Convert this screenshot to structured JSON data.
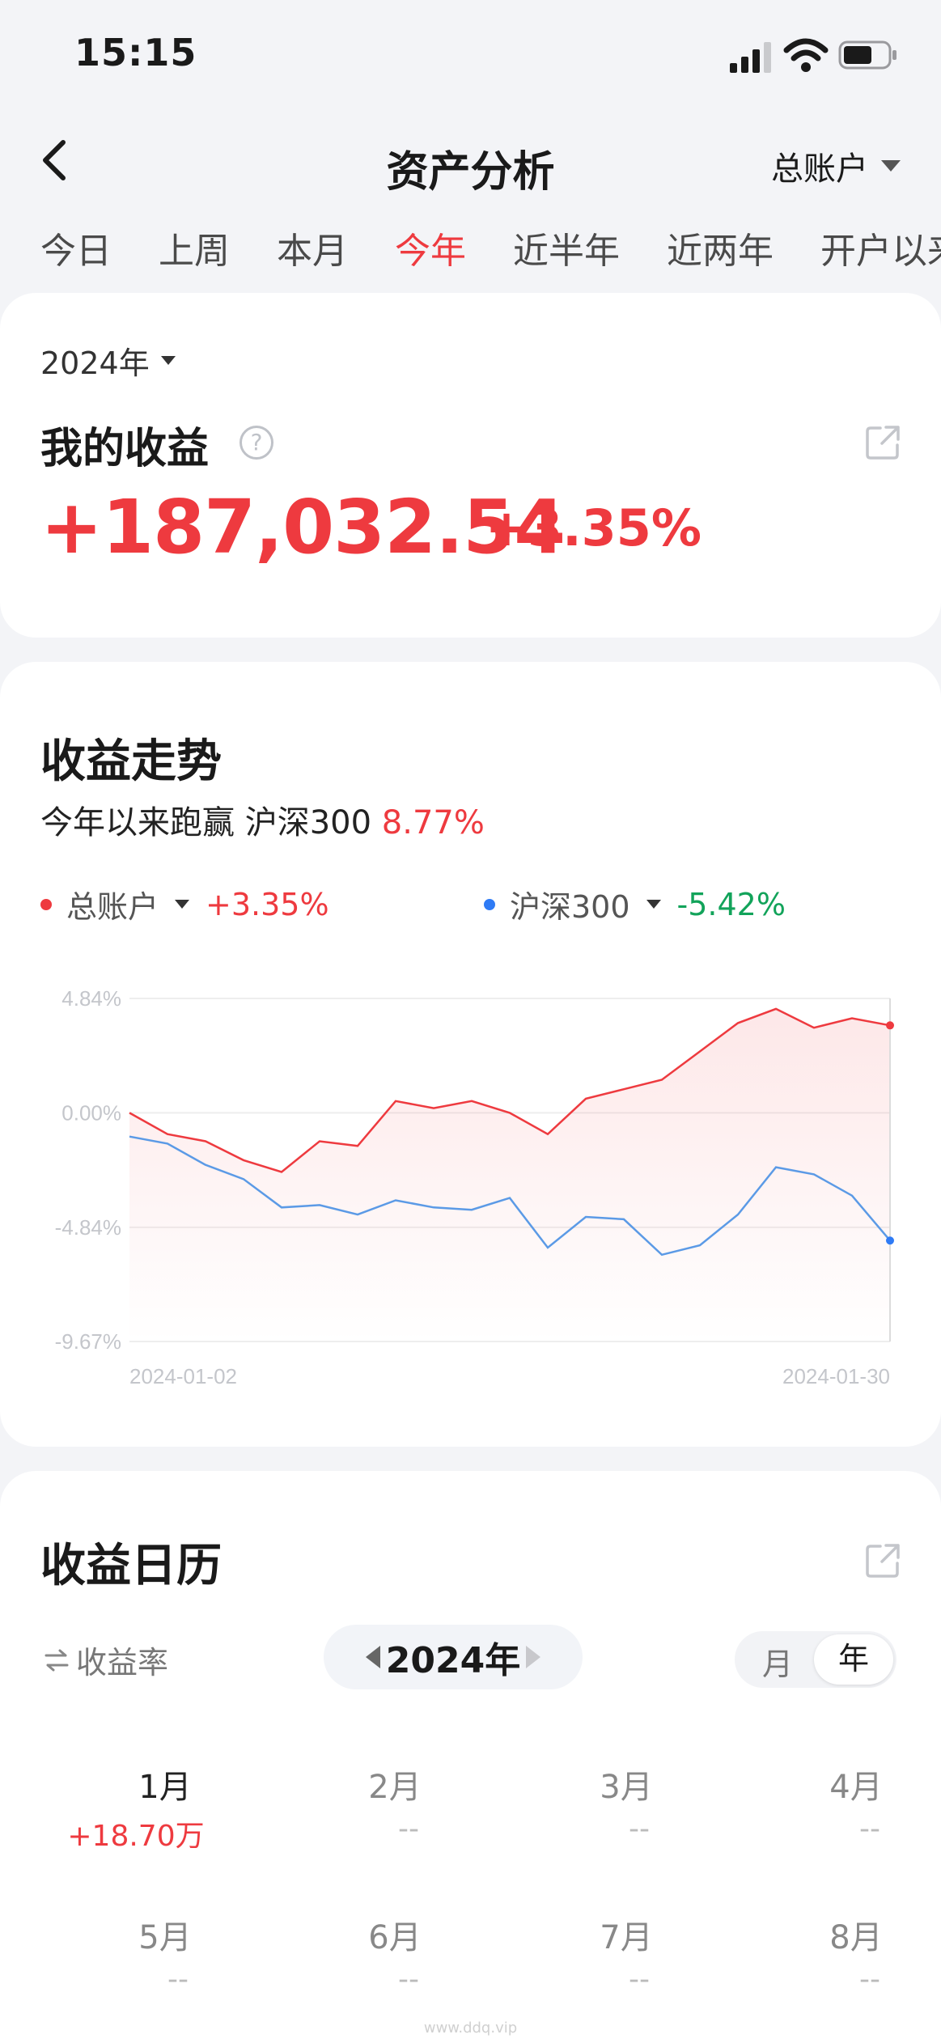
{
  "status": {
    "time": "15:15"
  },
  "nav": {
    "title": "资产分析",
    "account": "总账户"
  },
  "tabs": [
    "今日",
    "上周",
    "本月",
    "今年",
    "近半年",
    "近两年",
    "开户以来"
  ],
  "summary": {
    "year": "2024年",
    "title": "我的收益",
    "help": "?",
    "amount": "+187,032.54",
    "pct": "+3.35%"
  },
  "trend": {
    "title": "收益走势",
    "beat_text": "今年以来跑赢 沪深300",
    "beat_pct": "8.77%",
    "legend": [
      {
        "name": "总账户",
        "value": "+3.35%",
        "color": "#ee3a3f"
      },
      {
        "name": "沪深300",
        "value": "-5.42%",
        "color": "#2f7bf5"
      }
    ]
  },
  "chart_data": {
    "type": "line",
    "y_ticks": [
      "4.84%",
      "0.00%",
      "-4.84%",
      "-9.67%"
    ],
    "ylim": [
      -9.67,
      4.84
    ],
    "x_labels": [
      "2024-01-02",
      "2024-01-30"
    ],
    "series": [
      {
        "name": "总账户",
        "color": "#ee3a3f",
        "values": [
          0.0,
          -0.9,
          -1.2,
          -2.0,
          -2.5,
          -1.2,
          -1.4,
          0.5,
          0.2,
          0.5,
          0.0,
          -0.9,
          0.6,
          1.0,
          1.4,
          2.6,
          3.8,
          4.4,
          3.6,
          4.0,
          3.7
        ]
      },
      {
        "name": "沪深300",
        "color": "#5b9ae6",
        "values": [
          -1.0,
          -1.3,
          -2.2,
          -2.8,
          -4.0,
          -3.9,
          -4.3,
          -3.7,
          -4.0,
          -4.1,
          -3.6,
          -5.7,
          -4.4,
          -4.5,
          -6.0,
          -5.6,
          -4.3,
          -2.3,
          -2.6,
          -3.5,
          -5.4
        ]
      }
    ]
  },
  "calendar": {
    "title": "收益日历",
    "rate_label": "收益率",
    "rate_icon": "swap-arrows-icon",
    "year": "2024年",
    "seg_month": "月",
    "seg_year": "年",
    "months": [
      {
        "label": "1月",
        "value": "+18.70万"
      },
      {
        "label": "2月",
        "value": "--"
      },
      {
        "label": "3月",
        "value": "--"
      },
      {
        "label": "4月",
        "value": "--"
      },
      {
        "label": "5月",
        "value": "--"
      },
      {
        "label": "6月",
        "value": "--"
      },
      {
        "label": "7月",
        "value": "--"
      },
      {
        "label": "8月",
        "value": "--"
      }
    ]
  },
  "watermark": "www.ddq.vip"
}
